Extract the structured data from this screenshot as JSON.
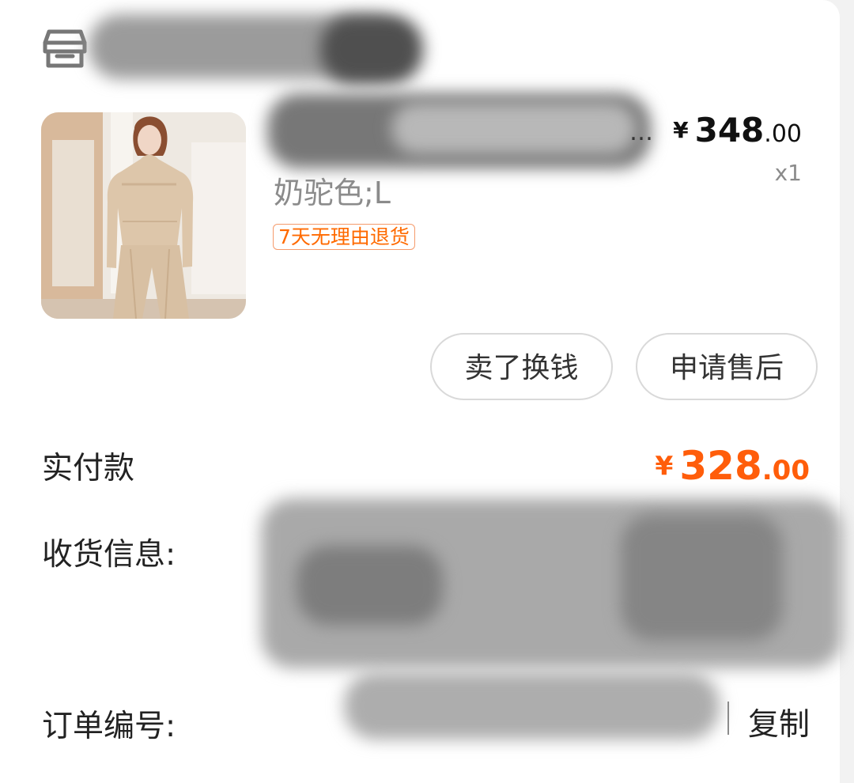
{
  "product": {
    "sku": "奶驼色;L",
    "title_tail": "…",
    "price": {
      "currency": "¥",
      "integer": "348",
      "decimal": ".00"
    },
    "quantity": "x1",
    "badge": "7天无理由退货"
  },
  "actions": {
    "resell": "卖了换钱",
    "after_sales": "申请售后"
  },
  "payment": {
    "label": "实付款",
    "amount": {
      "currency": "¥",
      "integer": "328",
      "decimal": ".00"
    }
  },
  "shipping": {
    "label": "收货信息:"
  },
  "order": {
    "label": "订单编号:",
    "copy_label": "复制"
  },
  "colors": {
    "accent": "#ff5d0a",
    "badge_border": "#f59b6c",
    "secondary_text": "#8b8b8b",
    "button_border": "#d9d9d9"
  },
  "icons": {
    "store": "store-icon",
    "product_photo": "sweater-model-image"
  }
}
